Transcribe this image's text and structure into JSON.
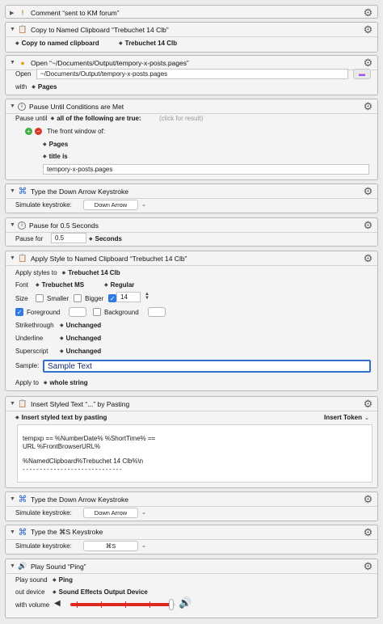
{
  "actions": {
    "comment": {
      "title": "Comment “sent to KM forum”"
    },
    "copy": {
      "title": "Copy to Named Clipboard “Trebuchet 14 Clb”",
      "popup": "Copy to named clipboard",
      "clipboard": "Trebuchet 14 Clb"
    },
    "open": {
      "title": "Open “~/Documents/Output/tempory-x-posts.pages”",
      "label": "Open",
      "path": "~/Documents/Output/tempory-x-posts.pages",
      "with_label": "with",
      "app": "Pages"
    },
    "pause_until": {
      "title": "Pause Until Conditions are Met",
      "label": "Pause until",
      "mode": "all of the following are true:",
      "hint": "(click for result)",
      "condition": "The front window of:",
      "app": "Pages",
      "test": "title is",
      "value": "tempory-x-posts.pages"
    },
    "down1": {
      "title": "Type the Down Arrow Keystroke",
      "label": "Simulate keystroke:",
      "key": "Down Arrow"
    },
    "pause": {
      "title": "Pause for 0.5 Seconds",
      "label": "Pause for",
      "value": "0.5",
      "unit": "Seconds"
    },
    "style": {
      "title": "Apply Style to Named Clipboard “Trebuchet 14 Clb”",
      "apply_label": "Apply styles to",
      "clipboard": "Trebuchet 14 Clb",
      "font_label": "Font",
      "font": "Trebuchet MS",
      "weight": "Regular",
      "size_label": "Size",
      "smaller": "Smaller",
      "bigger": "Bigger",
      "size": "14",
      "foreground": "Foreground",
      "background": "Background",
      "strike_label": "Strikethrough",
      "strike": "Unchanged",
      "underline_label": "Underline",
      "underline": "Unchanged",
      "super_label": "Superscript",
      "super": "Unchanged",
      "sample_label": "Sample:",
      "sample": "Sample Text",
      "applyto_label": "Apply to",
      "applyto": "whole string"
    },
    "insert": {
      "title": "Insert Styled Text “...” by Pasting",
      "popup": "Insert styled text by pasting",
      "token": "Insert Token",
      "line1": "tempxp == %NumberDate% %ShortTime% ==",
      "line2": "URL %FrontBrowserURL%",
      "line3": "%NamedClipboard%Trebuchet 14 Clb%\\n",
      "line4": "- - - - - - - - - - - - - - - - - - - - - - - - - - - - -"
    },
    "down2": {
      "title": "Type the Down Arrow Keystroke",
      "label": "Simulate keystroke:",
      "key": "Down Arrow"
    },
    "cmds": {
      "title": "Type the ⌘S Keystroke",
      "label": "Simulate keystroke:",
      "key": "⌘S"
    },
    "sound": {
      "title": "Play Sound “Ping”",
      "sound_label": "Play sound",
      "sound": "Ping",
      "device_label": "out device",
      "device": "Sound Effects Output Device",
      "volume_label": "with volume",
      "volume": 0.96
    }
  },
  "colors": {
    "accent": "#2f7ae5",
    "slider": "#e0271e",
    "sample_border": "#2f6fd0"
  }
}
